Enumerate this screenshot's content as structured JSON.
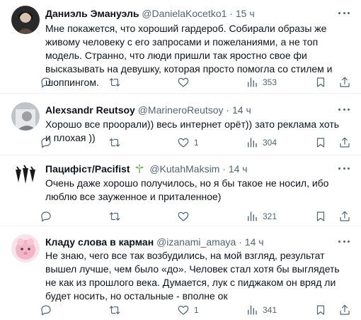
{
  "posts": [
    {
      "author": "Даниэль Эмануэль",
      "handle": "@DanielaKocetko1",
      "dot": "·",
      "time": "15 ч",
      "text": "Мне покажется, что хороший гардероб. Собирали образы же живому человеку с его запросами и пожеланиями, а не топ модель. Странно, что люди пришли так яростно свое фи высказывать на девушку, которая просто помогла со стилем и шоппингом.",
      "stats": {
        "replies": "",
        "reposts": "",
        "likes": "",
        "views": "353"
      }
    },
    {
      "author": "Alexsandr Reutsoy",
      "handle": "@MarineroReutsoy",
      "dot": "·",
      "time": "14 ч",
      "text": "Хорошо все проорали)) весь интернет орёт)) зато реклама хоть и плохая ))",
      "stats": {
        "replies": "",
        "reposts": "",
        "likes": "1",
        "views": "304"
      }
    },
    {
      "author": "Пацифіст/Pacifist",
      "handle": "@KutahMaksim",
      "dot": "·",
      "time": "14 ч",
      "text": "Очень даже хорошо получилось, но я бы такое не носил, ибо люблю все зауженное и приталенное)",
      "stats": {
        "replies": "",
        "reposts": "",
        "likes": "",
        "views": "321"
      }
    },
    {
      "author": "Кладу слова в карман",
      "handle": "@izanami_amaya",
      "dot": "·",
      "time": "14 ч",
      "text": "Не знаю, чего все так возбудились, на мой взгляд, результат вышел лучше, чем было «до». Человек стал хотя бы выглядеть не как из прошлого века. Думается, лук с пиджаком он вряд ли будет носить, но остальные - вполне ок",
      "stats": {
        "replies": "",
        "reposts": "",
        "likes": "1",
        "views": "341"
      }
    }
  ],
  "colors": {
    "text": "#0f1419",
    "muted": "#536471",
    "divider": "#eff3f4"
  }
}
